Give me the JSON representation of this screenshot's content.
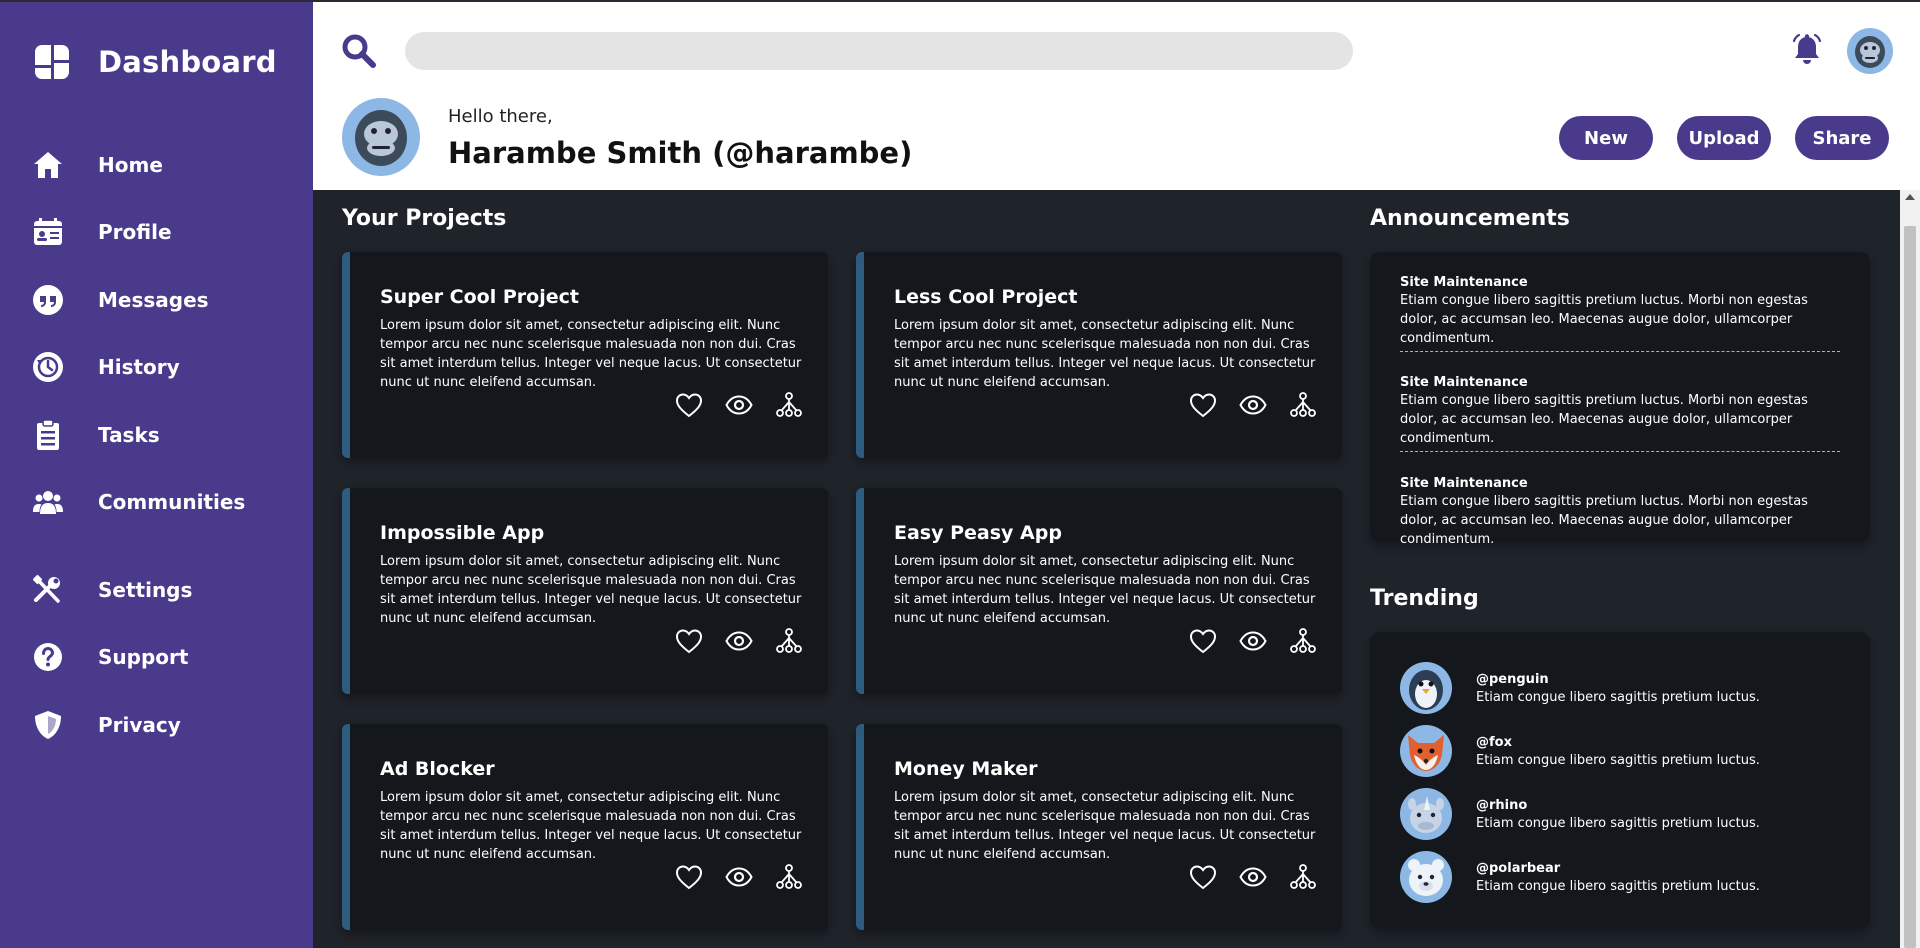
{
  "sidebar": {
    "title": "Dashboard",
    "items": [
      {
        "label": "Home",
        "icon": "home-icon"
      },
      {
        "label": "Profile",
        "icon": "profile-icon"
      },
      {
        "label": "Messages",
        "icon": "messages-icon"
      },
      {
        "label": "History",
        "icon": "history-icon"
      },
      {
        "label": "Tasks",
        "icon": "tasks-icon"
      },
      {
        "label": "Communities",
        "icon": "communities-icon"
      },
      {
        "label": "Settings",
        "icon": "settings-icon"
      },
      {
        "label": "Support",
        "icon": "support-icon"
      },
      {
        "label": "Privacy",
        "icon": "privacy-icon"
      }
    ]
  },
  "header": {
    "search_placeholder": "",
    "greeting": "Hello there,",
    "username": "Harambe Smith (@harambe)",
    "buttons": {
      "new": "New",
      "upload": "Upload",
      "share": "Share"
    }
  },
  "projects": {
    "title": "Your Projects",
    "items": [
      {
        "title": "Super Cool Project",
        "text": "Lorem ipsum dolor sit amet, consectetur adipiscing elit. Nunc tempor arcu nec nunc scelerisque malesuada non non dui. Cras sit amet interdum tellus. Integer vel neque lacus. Ut consectetur nunc ut nunc eleifend accumsan."
      },
      {
        "title": "Less Cool Project",
        "text": "Lorem ipsum dolor sit amet, consectetur adipiscing elit. Nunc tempor arcu nec nunc scelerisque malesuada non non dui. Cras sit amet interdum tellus. Integer vel neque lacus. Ut consectetur nunc ut nunc eleifend accumsan."
      },
      {
        "title": "Impossible App",
        "text": "Lorem ipsum dolor sit amet, consectetur adipiscing elit. Nunc tempor arcu nec nunc scelerisque malesuada non non dui. Cras sit amet interdum tellus. Integer vel neque lacus. Ut consectetur nunc ut nunc eleifend accumsan."
      },
      {
        "title": "Easy Peasy App",
        "text": "Lorem ipsum dolor sit amet, consectetur adipiscing elit. Nunc tempor arcu nec nunc scelerisque malesuada non non dui. Cras sit amet interdum tellus. Integer vel neque lacus. Ut consectetur nunc ut nunc eleifend accumsan."
      },
      {
        "title": "Ad Blocker",
        "text": "Lorem ipsum dolor sit amet, consectetur adipiscing elit. Nunc tempor arcu nec nunc scelerisque malesuada non non dui. Cras sit amet interdum tellus. Integer vel neque lacus. Ut consectetur nunc ut nunc eleifend accumsan."
      },
      {
        "title": "Money Maker",
        "text": "Lorem ipsum dolor sit amet, consectetur adipiscing elit. Nunc tempor arcu nec nunc scelerisque malesuada non non dui. Cras sit amet interdum tellus. Integer vel neque lacus. Ut consectetur nunc ut nunc eleifend accumsan."
      }
    ]
  },
  "announcements": {
    "title": "Announcements",
    "items": [
      {
        "title": "Site Maintenance",
        "text": "Etiam congue libero sagittis pretium luctus. Morbi non egestas dolor, ac accumsan leo. Maecenas augue dolor, ullamcorper condimentum."
      },
      {
        "title": "Site Maintenance",
        "text": "Etiam congue libero sagittis pretium luctus. Morbi non egestas dolor, ac accumsan leo. Maecenas augue dolor, ullamcorper condimentum."
      },
      {
        "title": "Site Maintenance",
        "text": "Etiam congue libero sagittis pretium luctus. Morbi non egestas dolor, ac accumsan leo. Maecenas augue dolor, ullamcorper condimentum."
      }
    ]
  },
  "trending": {
    "title": "Trending",
    "items": [
      {
        "handle": "@penguin",
        "text": "Etiam congue libero sagittis pretium luctus.",
        "avatar": "penguin-avatar"
      },
      {
        "handle": "@fox",
        "text": "Etiam congue libero sagittis pretium luctus.",
        "avatar": "fox-avatar"
      },
      {
        "handle": "@rhino",
        "text": "Etiam congue libero sagittis pretium luctus.",
        "avatar": "rhino-avatar"
      },
      {
        "handle": "@polarbear",
        "text": "Etiam congue libero sagittis pretium luctus.",
        "avatar": "polarbear-avatar"
      }
    ]
  },
  "colors": {
    "sidebar": "#4a3a8c",
    "accent": "#4a3a8c",
    "main_bg": "#1f232a",
    "card_bg": "#14181d",
    "card_border": "#2e5c7f"
  }
}
